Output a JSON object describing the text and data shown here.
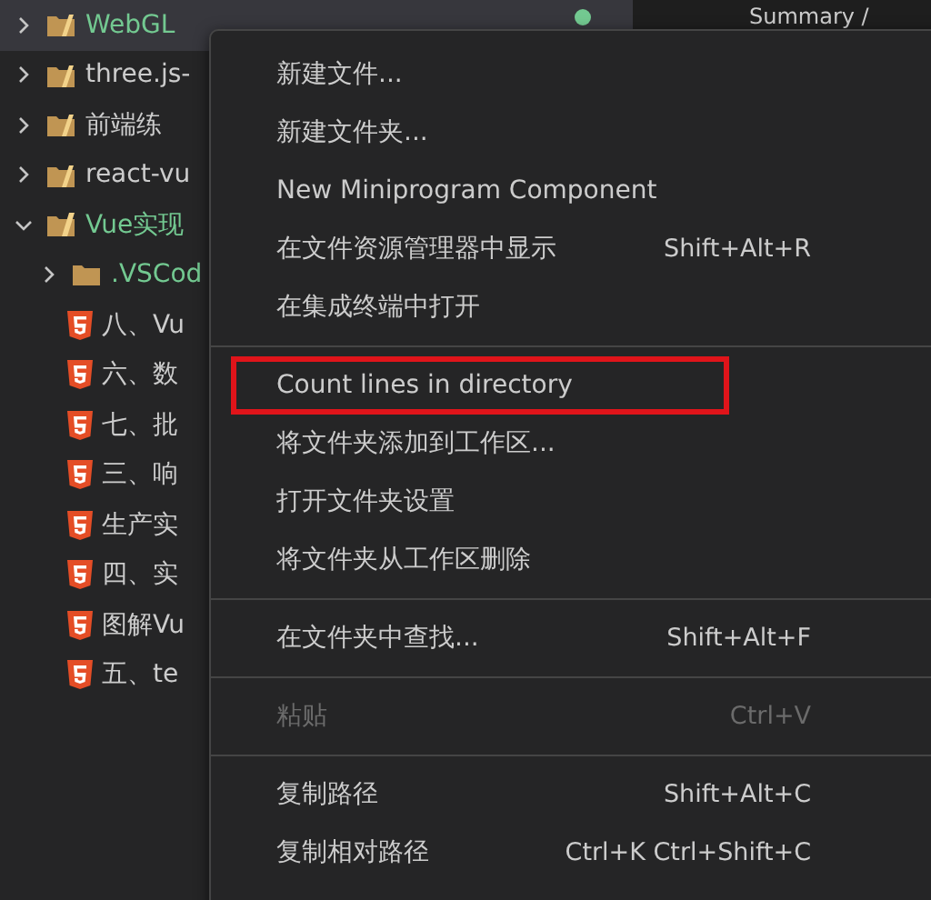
{
  "editor": {
    "breadcrumb": "Summary /"
  },
  "explorer": {
    "items": [
      {
        "kind": "folder",
        "label": "WebGL",
        "expanded": false,
        "selected": true,
        "color": "#73c991"
      },
      {
        "kind": "folder",
        "label": "three.js-",
        "expanded": false,
        "selected": false,
        "color": "#cccccc"
      },
      {
        "kind": "folder",
        "label": "前端练",
        "expanded": false,
        "selected": false,
        "color": "#cccccc"
      },
      {
        "kind": "folder",
        "label": "react-vu",
        "expanded": false,
        "selected": false,
        "color": "#cccccc"
      },
      {
        "kind": "folder",
        "label": "Vue实现",
        "expanded": true,
        "selected": false,
        "color": "#73c991",
        "children": [
          {
            "kind": "plainfolder",
            "label": ".VSCod",
            "expanded": false,
            "selected": false,
            "color": "#73c991"
          },
          {
            "kind": "html",
            "label": "八、Vu",
            "selected": false,
            "color": "#cccccc"
          },
          {
            "kind": "html",
            "label": "六、数",
            "selected": false,
            "color": "#cccccc"
          },
          {
            "kind": "html",
            "label": "七、批",
            "selected": false,
            "color": "#cccccc"
          },
          {
            "kind": "html",
            "label": "三、响",
            "selected": false,
            "color": "#cccccc"
          },
          {
            "kind": "html",
            "label": "生产实",
            "selected": false,
            "color": "#cccccc"
          },
          {
            "kind": "html",
            "label": "四、实",
            "selected": false,
            "color": "#cccccc"
          },
          {
            "kind": "html",
            "label": "图解Vu",
            "selected": false,
            "color": "#cccccc"
          },
          {
            "kind": "html",
            "label": "五、te",
            "selected": false,
            "color": "#cccccc"
          }
        ]
      }
    ]
  },
  "context_menu": {
    "groups": [
      [
        {
          "label": "新建文件...",
          "disabled": false,
          "highlighted": false
        },
        {
          "label": "新建文件夹...",
          "disabled": false,
          "highlighted": false
        },
        {
          "label": "New Miniprogram Component",
          "disabled": false,
          "highlighted": false
        },
        {
          "label": "在文件资源管理器中显示",
          "shortcut": "Shift+Alt+R",
          "disabled": false,
          "highlighted": false
        },
        {
          "label": "在集成终端中打开",
          "disabled": false,
          "highlighted": false
        }
      ],
      [
        {
          "label": "Count lines in directory",
          "disabled": false,
          "highlighted": true
        },
        {
          "label": "将文件夹添加到工作区...",
          "disabled": false,
          "highlighted": false
        },
        {
          "label": "打开文件夹设置",
          "disabled": false,
          "highlighted": false
        },
        {
          "label": "将文件夹从工作区删除",
          "disabled": false,
          "highlighted": false
        }
      ],
      [
        {
          "label": "在文件夹中查找...",
          "shortcut": "Shift+Alt+F",
          "disabled": false,
          "highlighted": false
        }
      ],
      [
        {
          "label": "粘贴",
          "shortcut": "Ctrl+V",
          "disabled": true,
          "highlighted": false
        }
      ],
      [
        {
          "label": "复制路径",
          "shortcut": "Shift+Alt+C",
          "disabled": false,
          "highlighted": false
        },
        {
          "label": "复制相对路径",
          "shortcut": "Ctrl+K Ctrl+Shift+C",
          "disabled": false,
          "highlighted": false
        }
      ]
    ]
  }
}
